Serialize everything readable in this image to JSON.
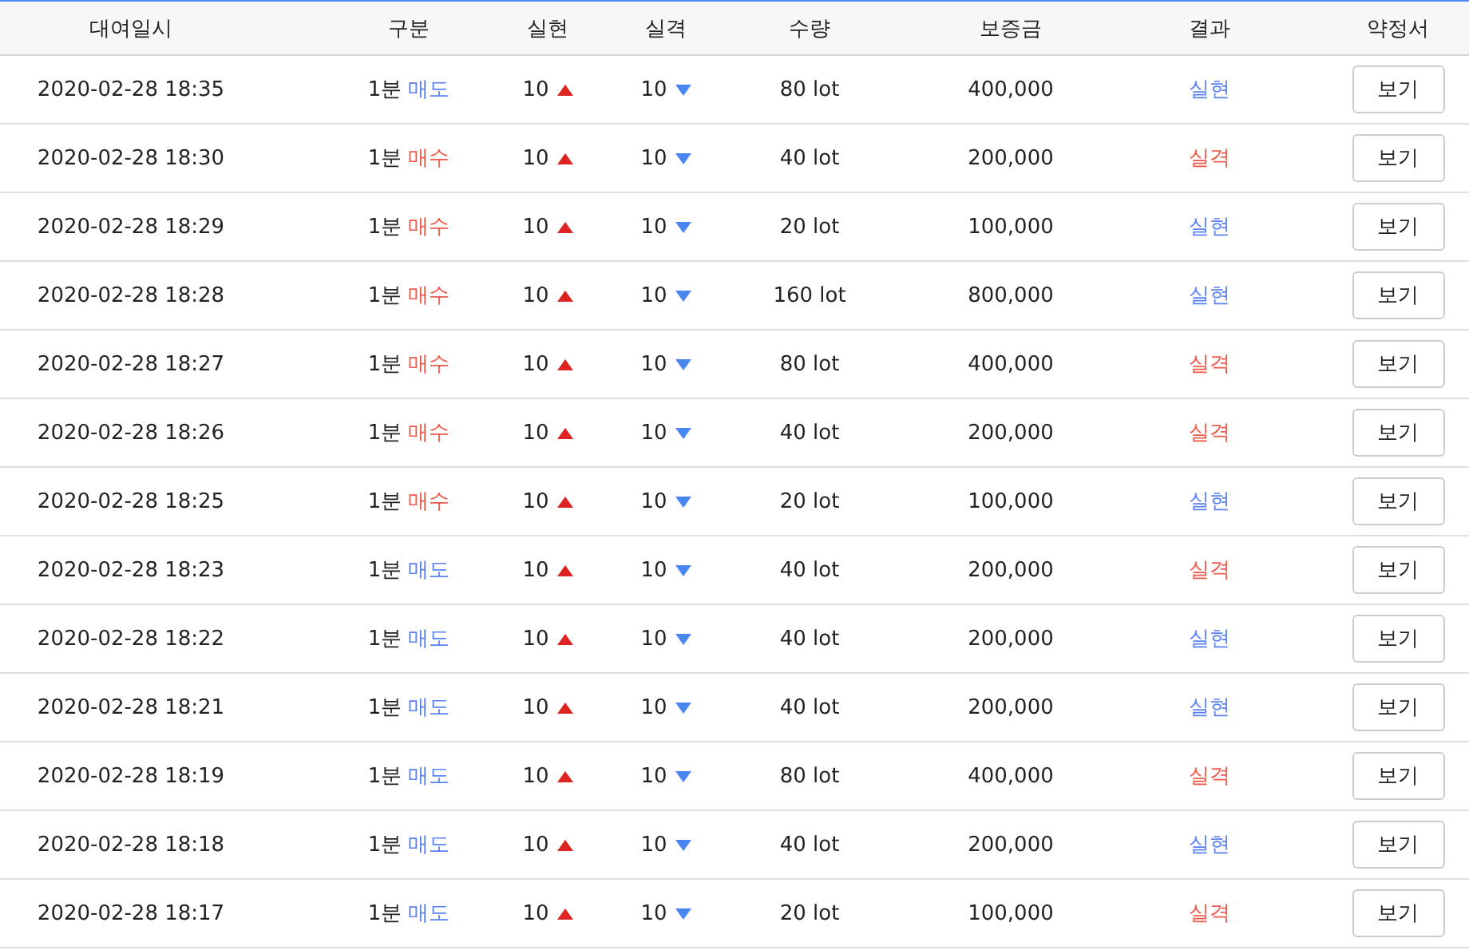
{
  "columns": [
    "대여일시",
    "구분",
    "실현",
    "실격",
    "수량",
    "보증금",
    "결과",
    "약정서"
  ],
  "rows": [
    {
      "time": "2020-02-28 18:35",
      "period": "1분",
      "side": {
        "kind": "sell",
        "label": "매도"
      },
      "realized": "10",
      "lost": "10",
      "qty": "80 lot",
      "deposit": "400,000",
      "result": {
        "kind": "win",
        "label": "실현"
      },
      "action": "보기"
    },
    {
      "time": "2020-02-28 18:30",
      "period": "1분",
      "side": {
        "kind": "buy",
        "label": "매수"
      },
      "realized": "10",
      "lost": "10",
      "qty": "40 lot",
      "deposit": "200,000",
      "result": {
        "kind": "lose",
        "label": "실격"
      },
      "action": "보기"
    },
    {
      "time": "2020-02-28 18:29",
      "period": "1분",
      "side": {
        "kind": "buy",
        "label": "매수"
      },
      "realized": "10",
      "lost": "10",
      "qty": "20 lot",
      "deposit": "100,000",
      "result": {
        "kind": "win",
        "label": "실현"
      },
      "action": "보기"
    },
    {
      "time": "2020-02-28 18:28",
      "period": "1분",
      "side": {
        "kind": "buy",
        "label": "매수"
      },
      "realized": "10",
      "lost": "10",
      "qty": "160 lot",
      "deposit": "800,000",
      "result": {
        "kind": "win",
        "label": "실현"
      },
      "action": "보기"
    },
    {
      "time": "2020-02-28 18:27",
      "period": "1분",
      "side": {
        "kind": "buy",
        "label": "매수"
      },
      "realized": "10",
      "lost": "10",
      "qty": "80 lot",
      "deposit": "400,000",
      "result": {
        "kind": "lose",
        "label": "실격"
      },
      "action": "보기"
    },
    {
      "time": "2020-02-28 18:26",
      "period": "1분",
      "side": {
        "kind": "buy",
        "label": "매수"
      },
      "realized": "10",
      "lost": "10",
      "qty": "40 lot",
      "deposit": "200,000",
      "result": {
        "kind": "lose",
        "label": "실격"
      },
      "action": "보기"
    },
    {
      "time": "2020-02-28 18:25",
      "period": "1분",
      "side": {
        "kind": "buy",
        "label": "매수"
      },
      "realized": "10",
      "lost": "10",
      "qty": "20 lot",
      "deposit": "100,000",
      "result": {
        "kind": "win",
        "label": "실현"
      },
      "action": "보기"
    },
    {
      "time": "2020-02-28 18:23",
      "period": "1분",
      "side": {
        "kind": "sell",
        "label": "매도"
      },
      "realized": "10",
      "lost": "10",
      "qty": "40 lot",
      "deposit": "200,000",
      "result": {
        "kind": "lose",
        "label": "실격"
      },
      "action": "보기"
    },
    {
      "time": "2020-02-28 18:22",
      "period": "1분",
      "side": {
        "kind": "sell",
        "label": "매도"
      },
      "realized": "10",
      "lost": "10",
      "qty": "40 lot",
      "deposit": "200,000",
      "result": {
        "kind": "win",
        "label": "실현"
      },
      "action": "보기"
    },
    {
      "time": "2020-02-28 18:21",
      "period": "1분",
      "side": {
        "kind": "sell",
        "label": "매도"
      },
      "realized": "10",
      "lost": "10",
      "qty": "40 lot",
      "deposit": "200,000",
      "result": {
        "kind": "win",
        "label": "실현"
      },
      "action": "보기"
    },
    {
      "time": "2020-02-28 18:19",
      "period": "1분",
      "side": {
        "kind": "sell",
        "label": "매도"
      },
      "realized": "10",
      "lost": "10",
      "qty": "80 lot",
      "deposit": "400,000",
      "result": {
        "kind": "lose",
        "label": "실격"
      },
      "action": "보기"
    },
    {
      "time": "2020-02-28 18:18",
      "period": "1분",
      "side": {
        "kind": "sell",
        "label": "매도"
      },
      "realized": "10",
      "lost": "10",
      "qty": "40 lot",
      "deposit": "200,000",
      "result": {
        "kind": "win",
        "label": "실현"
      },
      "action": "보기"
    },
    {
      "time": "2020-02-28 18:17",
      "period": "1분",
      "side": {
        "kind": "sell",
        "label": "매도"
      },
      "realized": "10",
      "lost": "10",
      "qty": "20 lot",
      "deposit": "100,000",
      "result": {
        "kind": "lose",
        "label": "실격"
      },
      "action": "보기"
    }
  ]
}
